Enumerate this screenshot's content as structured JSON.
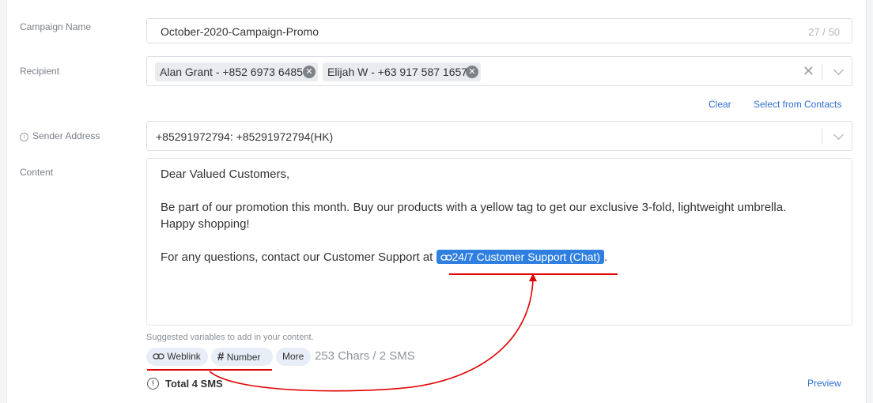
{
  "campaign": {
    "label": "Campaign Name",
    "value": "October-2020-Campaign-Promo",
    "count": "27 / 50"
  },
  "recipient": {
    "label": "Recipient",
    "chips": [
      "Alan Grant - +852 6973 6485",
      "Elijah W - +63 917 587 1657"
    ],
    "clear_label": "Clear",
    "select_contacts_label": "Select from Contacts"
  },
  "sender": {
    "label": "Sender Address",
    "value": "+85291972794: +85291972794(HK)"
  },
  "content": {
    "label": "Content",
    "greeting": "Dear Valued Customers,",
    "body1": "Be part of our promotion this month. Buy our products with a yellow tag to get our exclusive 3-fold, lightweight umbrella.",
    "body2": "Happy shopping!",
    "body3": "For any questions, contact our Customer Support at",
    "variable": "24/7 Customer Support (Chat)",
    "trailing": "."
  },
  "suggestions": {
    "hint": "Suggested variables to add in your content.",
    "weblink": "Weblink",
    "number": "Number",
    "more": "More",
    "chars": "253 Chars / 2 SMS"
  },
  "summary": {
    "total": "Total 4 SMS",
    "preview_label": "Preview"
  },
  "colors": {
    "accent": "#2f7fe0",
    "annotation": "#e00000"
  }
}
